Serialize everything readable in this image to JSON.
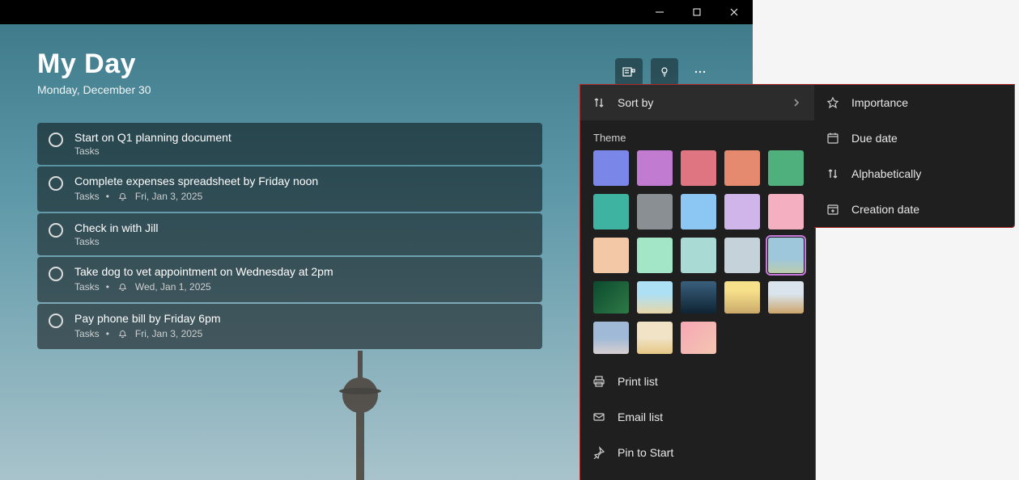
{
  "header": {
    "title": "My Day",
    "date": "Monday, December 30"
  },
  "tasks": [
    {
      "title": "Start on Q1 planning document",
      "list": "Tasks",
      "reminder": null,
      "due": null
    },
    {
      "title": "Complete expenses spreadsheet by Friday noon",
      "list": "Tasks",
      "reminder": true,
      "due": "Fri, Jan 3, 2025"
    },
    {
      "title": "Check in with Jill",
      "list": "Tasks",
      "reminder": null,
      "due": null
    },
    {
      "title": "Take dog to vet appointment on Wednesday at 2pm",
      "list": "Tasks",
      "reminder": true,
      "due": "Wed, Jan 1, 2025"
    },
    {
      "title": "Pay phone bill by Friday 6pm",
      "list": "Tasks",
      "reminder": true,
      "due": "Fri, Jan 3, 2025"
    }
  ],
  "menu": {
    "sort_label": "Sort by",
    "theme_label": "Theme",
    "print_label": "Print list",
    "email_label": "Email list",
    "pin_label": "Pin to Start"
  },
  "sort_options": {
    "importance": "Importance",
    "due": "Due date",
    "alpha": "Alphabetically",
    "creation": "Creation date"
  },
  "theme_colors_row1": [
    "#7a86e8",
    "#c17bd1",
    "#e07582",
    "#e58a6f",
    "#4fb07d"
  ],
  "theme_colors_row2": [
    "#3fb3a1",
    "#8a8f93",
    "#8cc6f2",
    "#d0b5ea",
    "#f4b0c1"
  ],
  "theme_colors_row3": [
    "#f2c8a6",
    "#a2e6c7",
    "#a9dad3",
    "#c6d2da",
    "image-tower"
  ],
  "theme_images_row4": [
    "img-leaves",
    "img-beach",
    "img-mountain",
    "img-sunset",
    "img-desert"
  ],
  "theme_images_row5": [
    "img-lighthouse",
    "img-balloon",
    "img-pink"
  ],
  "selected_theme_index": 14
}
